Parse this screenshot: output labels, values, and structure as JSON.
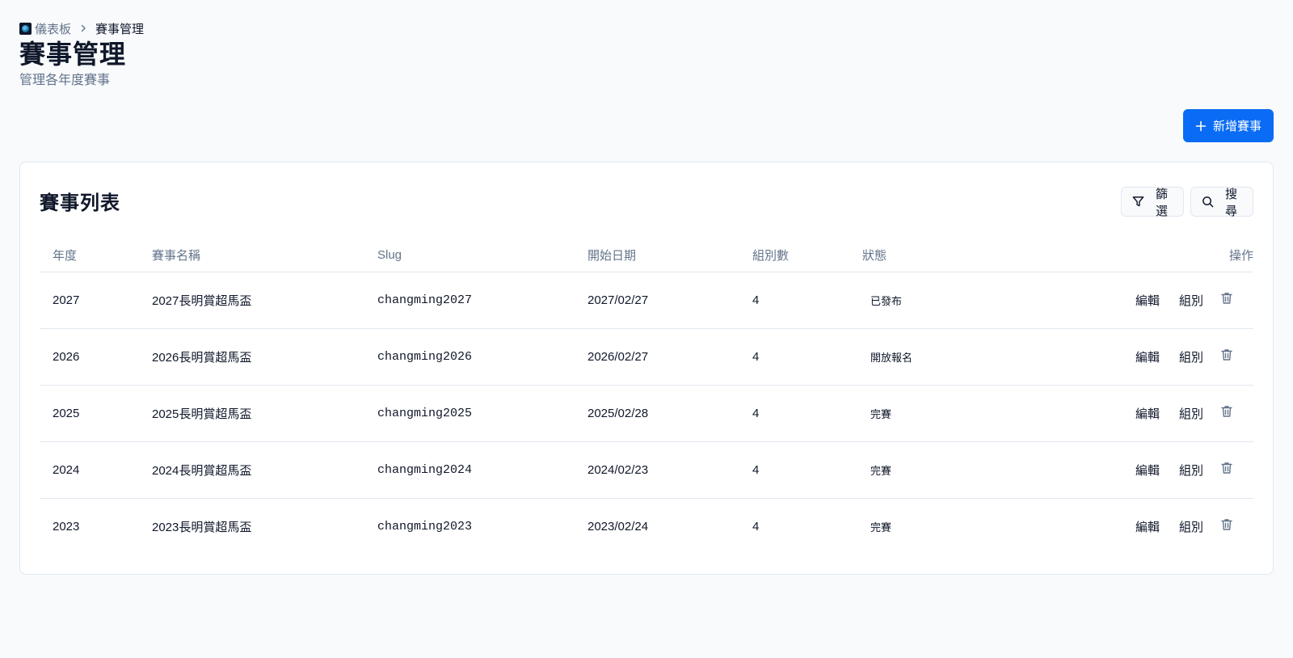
{
  "breadcrumb": {
    "home": "儀表板",
    "current": "賽事管理"
  },
  "page": {
    "title": "賽事管理",
    "subtitle": "管理各年度賽事"
  },
  "toolbar": {
    "add_label": "新增賽事"
  },
  "card": {
    "title": "賽事列表",
    "filter_label": "篩選",
    "search_label": "搜尋"
  },
  "table": {
    "headers": {
      "year": "年度",
      "name": "賽事名稱",
      "slug": "Slug",
      "start": "開始日期",
      "groups": "組別數",
      "status": "狀態",
      "actions": "操作"
    },
    "rows": [
      {
        "year": "2027",
        "name": "2027長明賞超馬盃",
        "slug": "changming2027",
        "start": "2027/02/27",
        "groups": "4",
        "status": "已發布",
        "edit": "編輯",
        "group": "組別"
      },
      {
        "year": "2026",
        "name": "2026長明賞超馬盃",
        "slug": "changming2026",
        "start": "2026/02/27",
        "groups": "4",
        "status": "開放報名",
        "edit": "編輯",
        "group": "組別"
      },
      {
        "year": "2025",
        "name": "2025長明賞超馬盃",
        "slug": "changming2025",
        "start": "2025/02/28",
        "groups": "4",
        "status": "完賽",
        "edit": "編輯",
        "group": "組別"
      },
      {
        "year": "2024",
        "name": "2024長明賞超馬盃",
        "slug": "changming2024",
        "start": "2024/02/23",
        "groups": "4",
        "status": "完賽",
        "edit": "編輯",
        "group": "組別"
      },
      {
        "year": "2023",
        "name": "2023長明賞超馬盃",
        "slug": "changming2023",
        "start": "2023/02/24",
        "groups": "4",
        "status": "完賽",
        "edit": "編輯",
        "group": "組別"
      }
    ]
  },
  "colors": {
    "primary": "#0a6cf5",
    "muted": "#64748b",
    "border": "#e2e8f0",
    "background": "#f8fafc"
  }
}
